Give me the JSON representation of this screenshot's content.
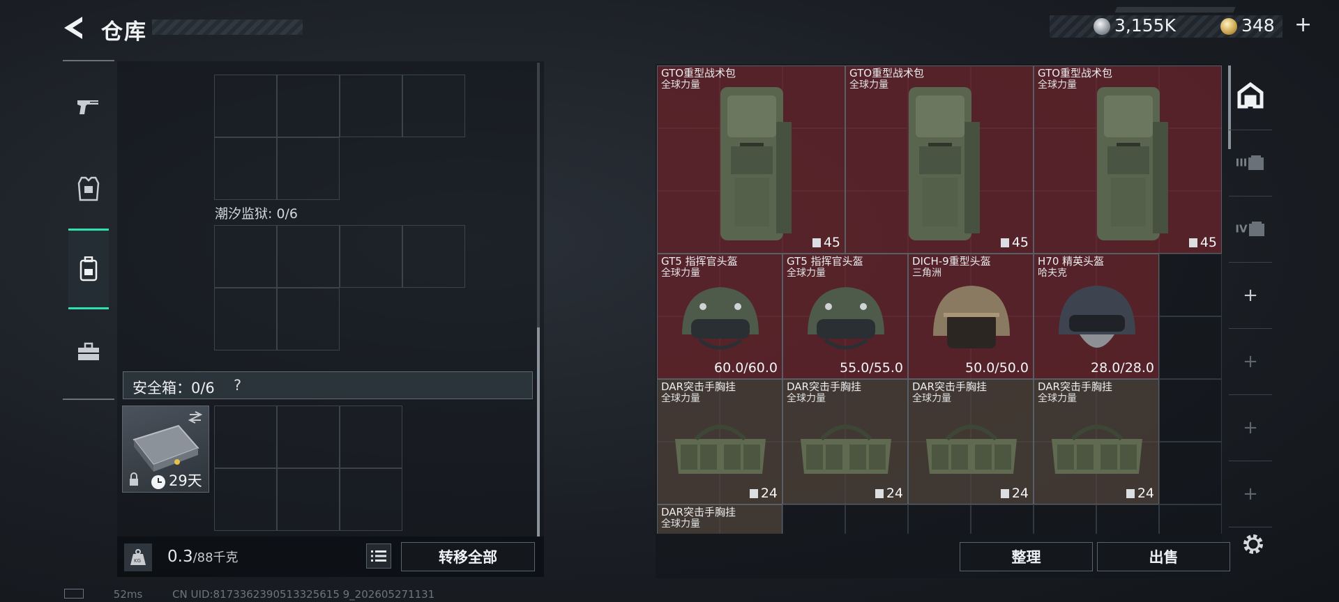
{
  "header": {
    "title": "仓库",
    "currency_silver": "3,155K",
    "currency_gold": "348",
    "add_label": "+"
  },
  "left_nav": {
    "items": [
      {
        "name": "weapons",
        "icon": "pistol-icon"
      },
      {
        "name": "equipment",
        "icon": "armor-vest-icon"
      },
      {
        "name": "backpack",
        "icon": "backpack-icon",
        "active": true
      },
      {
        "name": "toolbox",
        "icon": "toolbox-icon"
      }
    ]
  },
  "containers": {
    "prison_label": "潮汐监狱: 0/6",
    "safe_box_label": "安全箱：0/6",
    "safe_box_help": "?",
    "safe_box_days": "29天"
  },
  "footer": {
    "weight_value": "0.3",
    "weight_unit": "/88千克",
    "transfer_all": "转移全部",
    "sort": "整理",
    "sell": "出售"
  },
  "storage": {
    "items": [
      {
        "name": "GTO重型战术包",
        "sub": "全球力量",
        "value": "45",
        "kind": "backpack",
        "color": "red"
      },
      {
        "name": "GTO重型战术包",
        "sub": "全球力量",
        "value": "45",
        "kind": "backpack",
        "color": "red"
      },
      {
        "name": "GTO重型战术包",
        "sub": "全球力量",
        "value": "45",
        "kind": "backpack",
        "color": "red"
      },
      {
        "name": "GT5 指挥官头盔",
        "sub": "全球力量",
        "value": "60.0/60.0",
        "kind": "helmet",
        "color": "red"
      },
      {
        "name": "GT5 指挥官头盔",
        "sub": "全球力量",
        "value": "55.0/55.0",
        "kind": "helmet",
        "color": "red"
      },
      {
        "name": "DICH-9重型头盔",
        "sub": "三角洲",
        "value": "50.0/50.0",
        "kind": "helmet-tan",
        "color": "red"
      },
      {
        "name": "H70 精英头盔",
        "sub": "哈夫克",
        "value": "28.0/28.0",
        "kind": "helmet-dark",
        "color": "red"
      },
      {
        "name": "DAR突击手胸挂",
        "sub": "全球力量",
        "value": "24",
        "kind": "rig",
        "color": "brown"
      },
      {
        "name": "DAR突击手胸挂",
        "sub": "全球力量",
        "value": "24",
        "kind": "rig",
        "color": "brown"
      },
      {
        "name": "DAR突击手胸挂",
        "sub": "全球力量",
        "value": "24",
        "kind": "rig",
        "color": "brown"
      },
      {
        "name": "DAR突击手胸挂",
        "sub": "全球力量",
        "value": "24",
        "kind": "rig",
        "color": "brown"
      },
      {
        "name": "DAR突击手胸挂",
        "sub": "全球力量",
        "value": "",
        "kind": "rig",
        "color": "brown"
      }
    ]
  },
  "right_nav": {
    "items": [
      {
        "icon": "storage-home-icon"
      },
      {
        "icon": "tier-iii-gear-icon",
        "label": "III"
      },
      {
        "icon": "tier-iv-gear-icon",
        "label": "IV"
      },
      {
        "icon": "add-slot-icon",
        "label": "+"
      },
      {
        "icon": "add-slot-icon",
        "label": "+"
      },
      {
        "icon": "add-slot-icon",
        "label": "+"
      },
      {
        "icon": "add-slot-icon",
        "label": "+"
      }
    ]
  },
  "status_bar": {
    "ping": "52ms",
    "uid": "CN UID:8173362390513325615 9_202605271131"
  },
  "colors": {
    "accent": "#2fe0b0",
    "rare_red": "#6e262c",
    "common_brown": "#52443a"
  }
}
